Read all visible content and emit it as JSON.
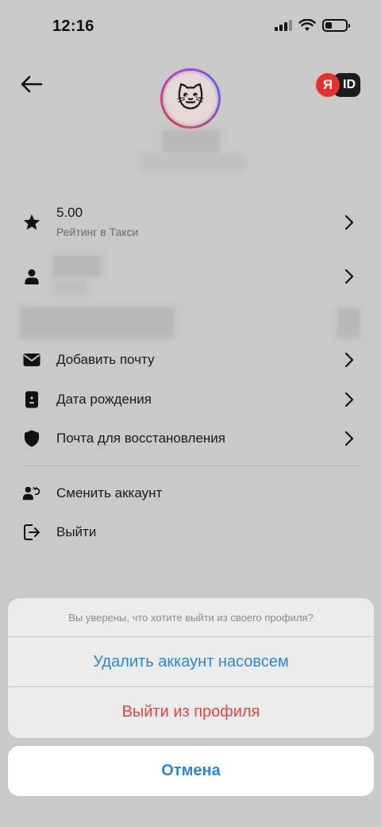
{
  "status_bar": {
    "time": "12:16"
  },
  "header": {
    "brand_ya": "Я",
    "brand_id": "ID"
  },
  "menu": {
    "rating_value": "5.00",
    "rating_label": "Рейтинг в Такси",
    "add_email": "Добавить почту",
    "birthday": "Дата рождения",
    "recovery_email": "Почта для восстановления",
    "switch_account": "Сменить аккаунт",
    "logout": "Выйти"
  },
  "action_sheet": {
    "title": "Вы уверены, что хотите выйти из своего профиля?",
    "delete_account": "Удалить аккаунт насовсем",
    "logout_profile": "Выйти из профиля",
    "cancel": "Отмена"
  },
  "colors": {
    "accent_blue": "#2e86d3",
    "destructive_red": "#e5443f",
    "brand_red": "#e8302a"
  }
}
